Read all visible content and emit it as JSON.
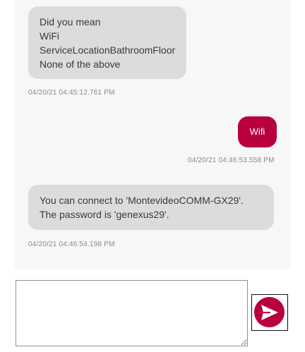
{
  "messages": [
    {
      "sender": "bot",
      "lines": [
        "Did you mean",
        "WiFi",
        "ServiceLocationBathroomFloor",
        "None of the above"
      ],
      "timestamp": "04/20/21 04:45:12.761 PM"
    },
    {
      "sender": "user",
      "text": "Wifi",
      "timestamp": "04/20/21 04:46:53.558 PM"
    },
    {
      "sender": "bot",
      "text": "You can connect to 'MontevideoCOMM-GX29'. The password is 'genexus29'.",
      "timestamp": "04/20/21 04:46:54.198 PM"
    }
  ],
  "composer": {
    "value": "",
    "placeholder": ""
  },
  "send_button": {
    "icon": "send-icon"
  },
  "colors": {
    "accent": "#b8003f",
    "bot_bubble": "#dcdcdc",
    "panel_bg": "#f7f7f7",
    "timestamp": "#8a8a8a"
  }
}
